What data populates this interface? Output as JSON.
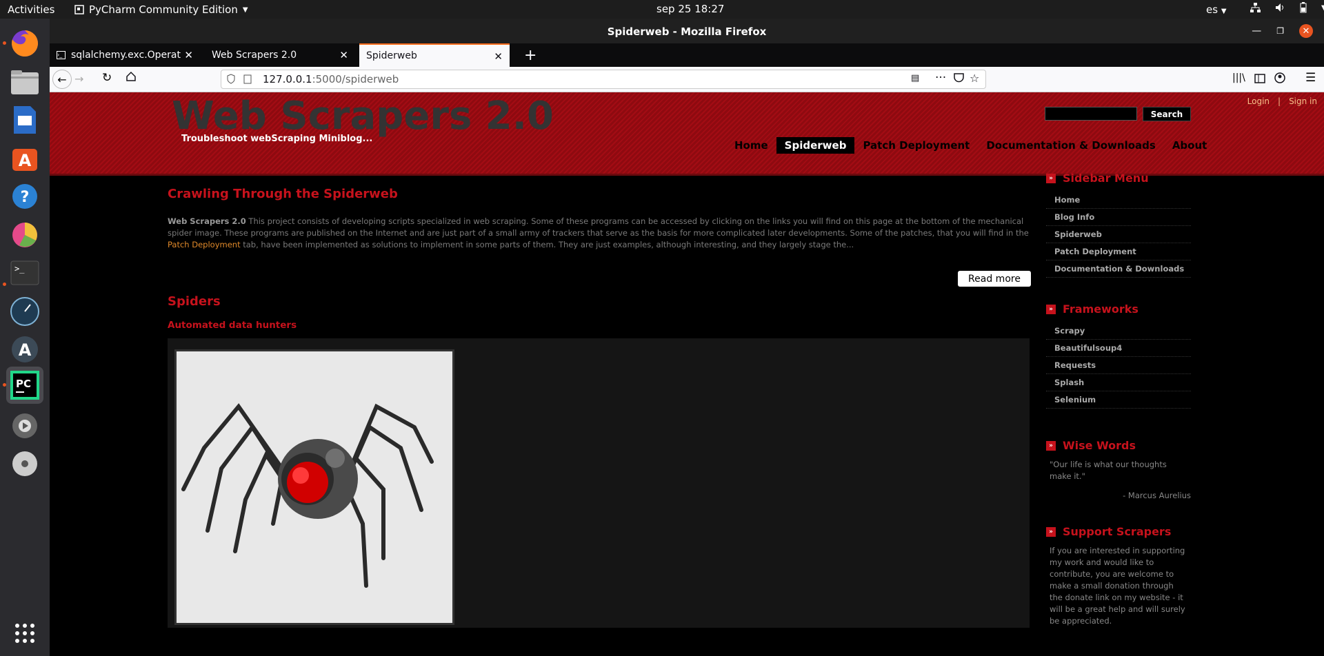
{
  "topbar": {
    "activities": "Activities",
    "app_name": "PyCharm Community Edition",
    "clock": "sep 25  18:27",
    "lang": "es"
  },
  "window": {
    "title": "Spiderweb - Mozilla Firefox"
  },
  "tabs": [
    {
      "label": "sqlalchemy.exc.Operatio",
      "active": false
    },
    {
      "label": "Web Scrapers 2.0",
      "active": false
    },
    {
      "label": "Spiderweb",
      "active": true
    }
  ],
  "url": {
    "host": "127.0.0.1",
    "rest": ":5000/spiderweb"
  },
  "site": {
    "logo": "Web Scrapers 2.0",
    "slogan": "Troubleshoot webScraping Miniblog...",
    "login": "Login",
    "sep": "|",
    "signin": "Sign in",
    "search_button": "Search",
    "nav": [
      "Home",
      "Spiderweb",
      "Patch Deployment",
      "Documentation & Downloads",
      "About"
    ],
    "nav_selected": "Spiderweb"
  },
  "post": {
    "title": "Crawling Through the Spiderweb",
    "bold_intro": "Web Scrapers 2.0",
    "text1": " This project consists of developing scripts specialized in web scraping. Some of these programs can be accessed by clicking on the links you will find on this page at the bottom of the mechanical spider image. These programs are published on the Internet and are just part of a small army of trackers that serve as the basis for more complicated later developments. Some of the patches, that you will find in the ",
    "link": "Patch Deployment",
    "text2": " tab, have been implemented as solutions to implement in some parts of them. They are just examples, although interesting, and they largely stage the...",
    "read_more": "Read more"
  },
  "section": {
    "title": "Spiders",
    "subtitle": "Automated data hunters"
  },
  "sidebar": {
    "menu_title": "Sidebar Menu",
    "menu_items": [
      "Home",
      "Blog Info",
      "Spiderweb",
      "Patch Deployment",
      "Documentation & Downloads"
    ],
    "frameworks_title": "Frameworks",
    "frameworks": [
      "Scrapy",
      "Beautifulsoup4",
      "Requests",
      "Splash",
      "Selenium"
    ],
    "wise_title": "Wise Words",
    "quote": "\"Our life is what our thoughts make it.\"",
    "author": "- Marcus Aurelius",
    "support_title": "Support Scrapers",
    "support_text": "If you are interested in supporting my work and would like to contribute, you are welcome to make a small donation through the donate link on my website - it will be a great help and will surely be appreciated."
  }
}
